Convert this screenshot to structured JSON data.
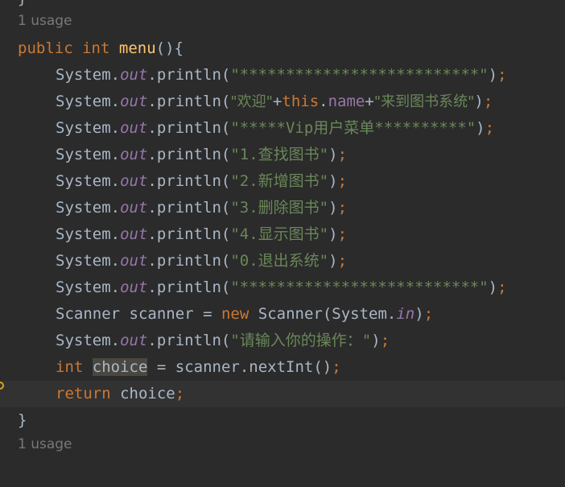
{
  "editor": {
    "top_brace": "}",
    "usage_hint_top": "1 usage",
    "usage_hint_bottom": "1 usage",
    "closing_brace": "}",
    "method_sig": {
      "modifier": "public",
      "type": "int",
      "name": "menu",
      "rest": "(){"
    },
    "lines": [
      {
        "prefix": "System.",
        "field": "out",
        "call": ".println(",
        "str": "\"**************************\"",
        "close": ")",
        "semi": ";"
      },
      {
        "prefix": "System.",
        "field": "out",
        "call": ".println(",
        "str1": "\"欢迎\"",
        "plus1": "+",
        "this_kw": "this",
        "dot": ".",
        "this_field": "name",
        "plus2": "+",
        "str2": "\"来到图书系统\"",
        "close": ")",
        "semi": ";"
      },
      {
        "prefix": "System.",
        "field": "out",
        "call": ".println(",
        "str": "\"*****Vip用户菜单**********\"",
        "close": ")",
        "semi": ";"
      },
      {
        "prefix": "System.",
        "field": "out",
        "call": ".println(",
        "str": "\"1.查找图书\"",
        "close": ")",
        "semi": ";"
      },
      {
        "prefix": "System.",
        "field": "out",
        "call": ".println(",
        "str": "\"2.新增图书\"",
        "close": ")",
        "semi": ";"
      },
      {
        "prefix": "System.",
        "field": "out",
        "call": ".println(",
        "str": "\"3.删除图书\"",
        "close": ")",
        "semi": ";"
      },
      {
        "prefix": "System.",
        "field": "out",
        "call": ".println(",
        "str": "\"4.显示图书\"",
        "close": ")",
        "semi": ";"
      },
      {
        "prefix": "System.",
        "field": "out",
        "call": ".println(",
        "str": "\"0.退出系统\"",
        "close": ")",
        "semi": ";"
      },
      {
        "prefix": "System.",
        "field": "out",
        "call": ".println(",
        "str": "\"**************************\"",
        "close": ")",
        "semi": ";"
      }
    ],
    "scanner_line": {
      "type": "Scanner",
      "var": "scanner",
      "eq": "=",
      "new_kw": "new",
      "ctor": "Scanner(System.",
      "field": "in",
      "close": ")",
      "semi": ";"
    },
    "prompt_line": {
      "prefix": "System.",
      "field": "out",
      "call": ".println(",
      "str": "\"请输入你的操作：\"",
      "close": ")",
      "semi": ";"
    },
    "choice_line": {
      "type": "int",
      "var": "choice",
      "rest": "= scanner.nextInt()",
      "semi": ";"
    },
    "return_line": {
      "kw": "return",
      "var": "choice",
      "semi": ";"
    }
  }
}
